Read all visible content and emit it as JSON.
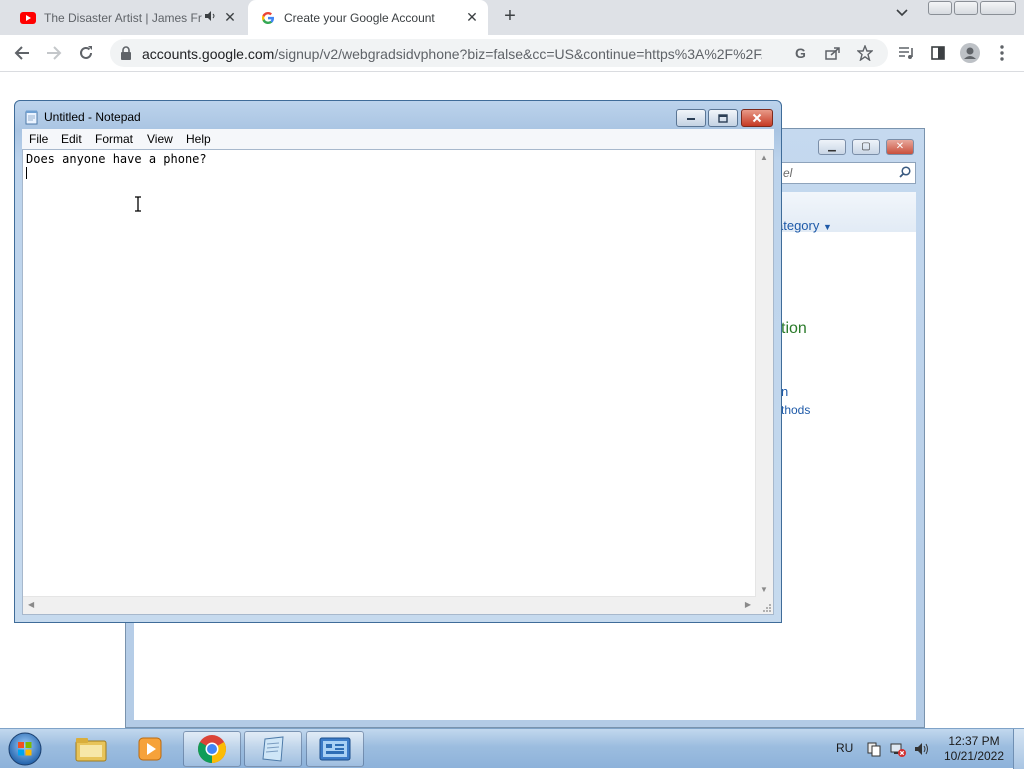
{
  "browser": {
    "tabs": [
      {
        "title": "The Disaster Artist | James Fr",
        "favicon": "youtube-icon",
        "audio": "speaker-icon"
      },
      {
        "title": "Create your Google Account",
        "favicon": "google-icon",
        "active": true
      }
    ],
    "url_host": "accounts.google.com",
    "url_path": "/signup/v2/webgradsidvphone?biz=false&cc=US&continue=https%3A%2F%2F..."
  },
  "control_panel": {
    "search_placeholder": "el",
    "view_by": "ategory",
    "link_tion": "tion",
    "link_n": "n",
    "link_thods": "thods"
  },
  "notepad": {
    "title": "Untitled - Notepad",
    "menu": [
      "File",
      "Edit",
      "Format",
      "View",
      "Help"
    ],
    "content": "Does anyone have a phone?"
  },
  "taskbar": {
    "language": "RU",
    "time": "12:37 PM",
    "date": "10/21/2022"
  },
  "colors": {
    "accent_blue": "#1a73e8",
    "youtube_red": "#ff0000",
    "cp_link": "#1e5aa8",
    "cp_green": "#2a7a2a"
  }
}
